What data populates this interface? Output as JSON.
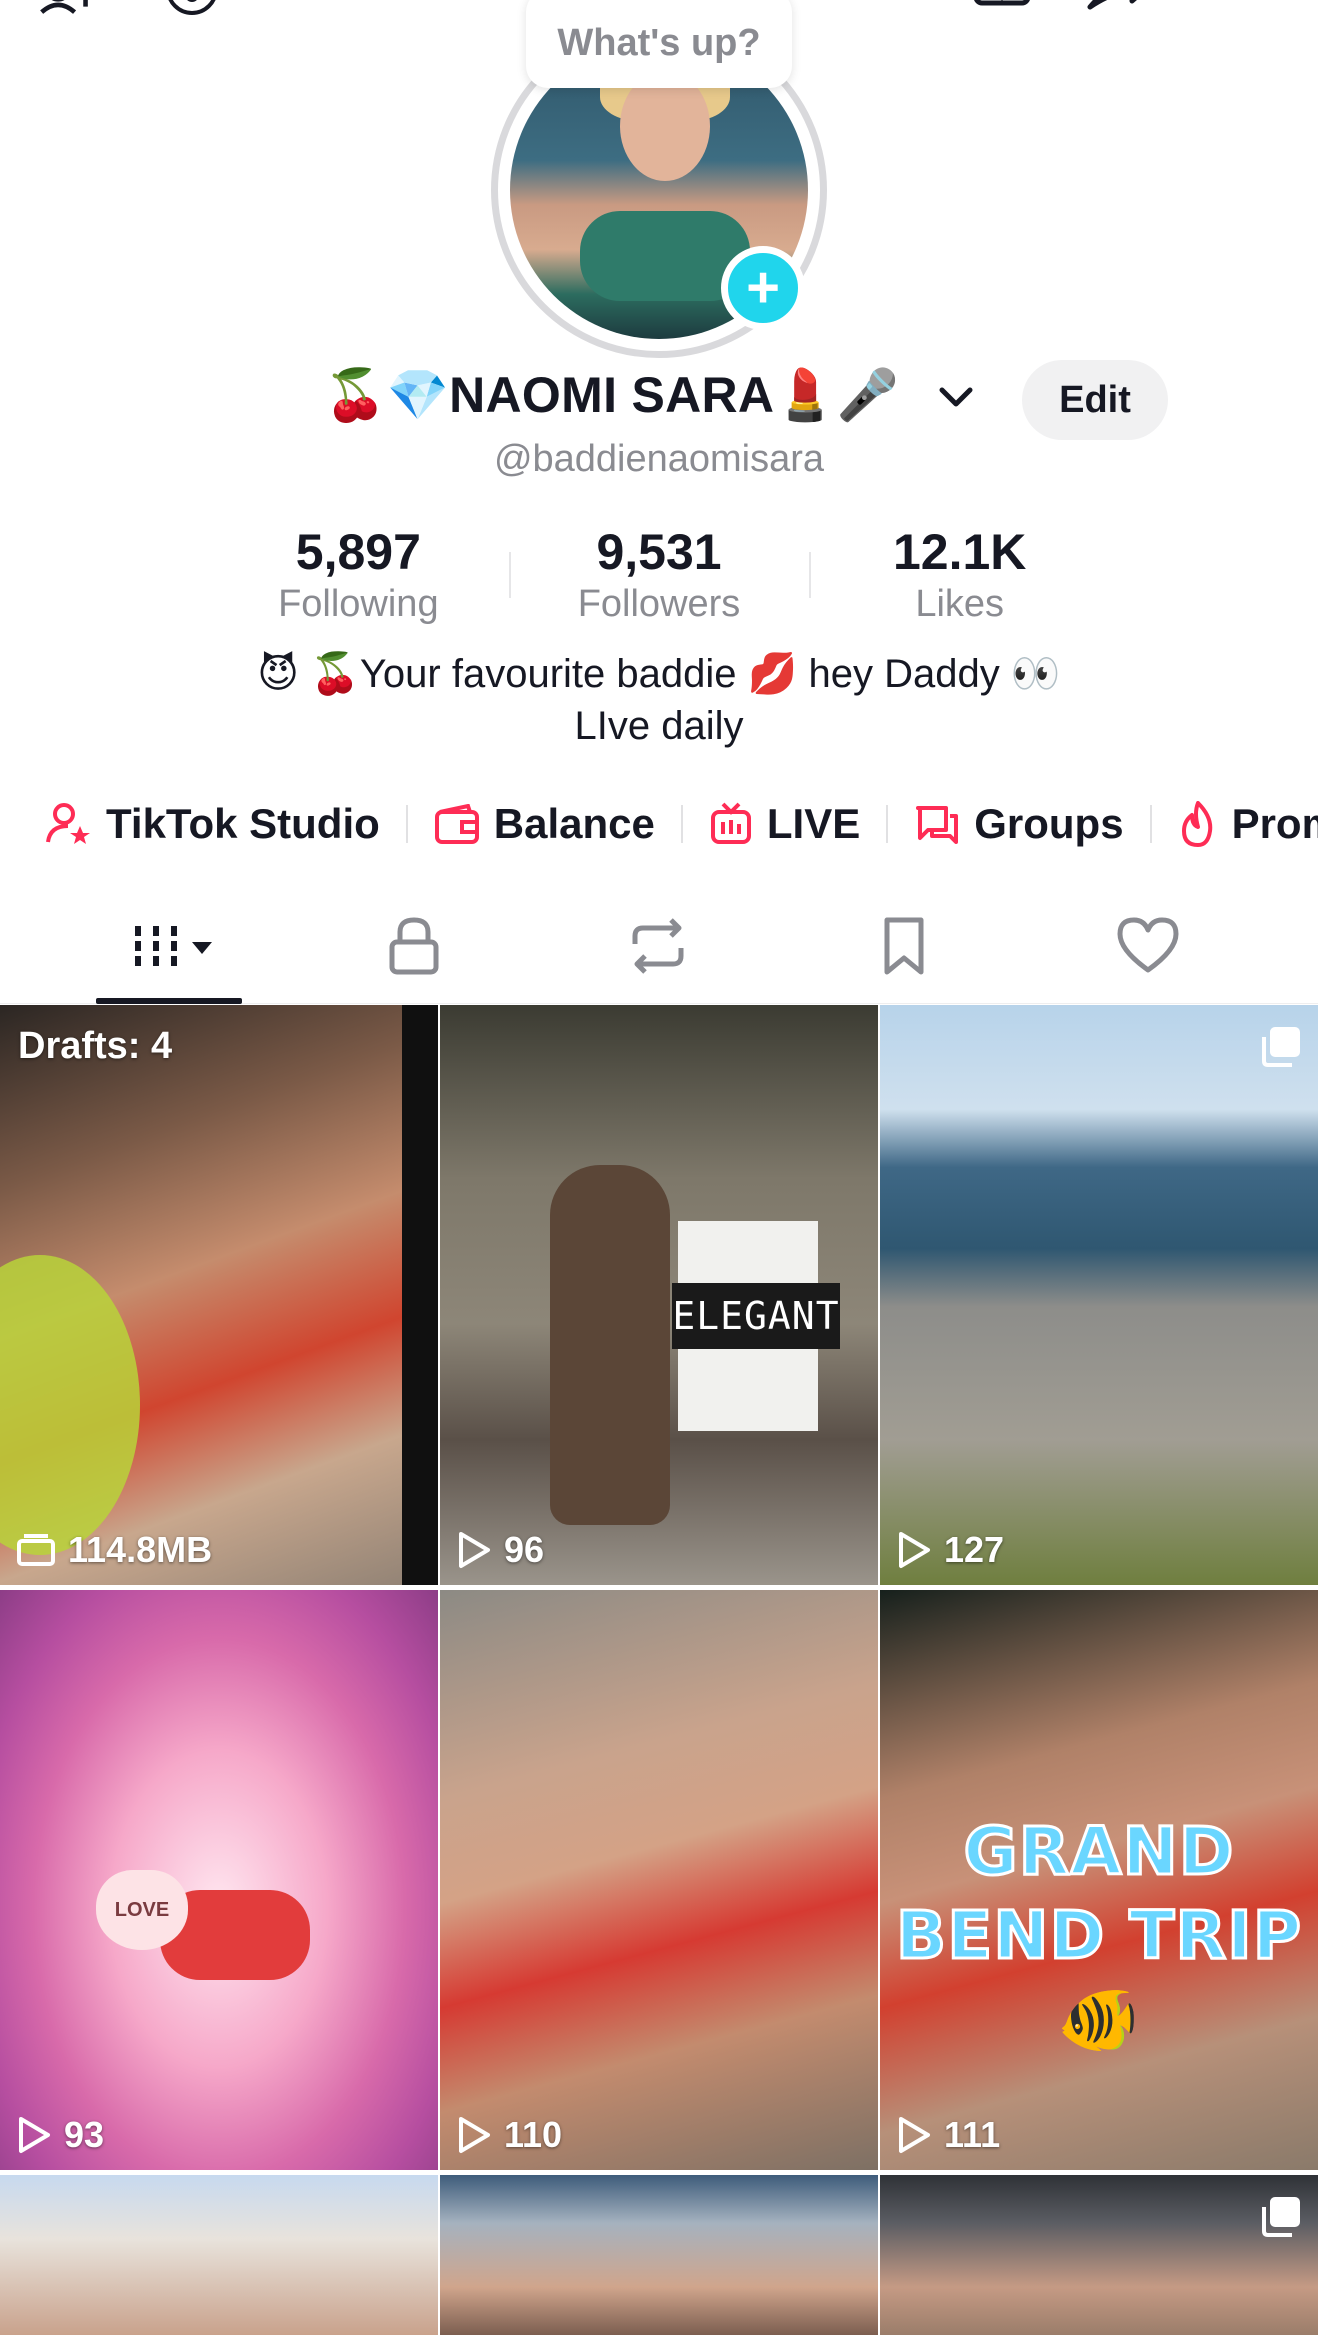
{
  "top": {
    "status_prompt": "What's up?"
  },
  "profile": {
    "name": "🍒💎NAOMI SARA💄🎤",
    "handle": "@baddienaomisara",
    "edit_label": "Edit"
  },
  "stats": [
    {
      "value": "5,897",
      "label": "Following"
    },
    {
      "value": "9,531",
      "label": "Followers"
    },
    {
      "value": "12.1K",
      "label": "Likes"
    }
  ],
  "bio": {
    "line1": "😈 🍒Your favourite baddie 💋 hey Daddy 👀",
    "line2": "LIve daily"
  },
  "shortcuts": [
    {
      "label": "TikTok Studio",
      "icon": "person-star-icon"
    },
    {
      "label": "Balance",
      "icon": "wallet-icon"
    },
    {
      "label": "LIVE",
      "icon": "tv-icon"
    },
    {
      "label": "Groups",
      "icon": "chat-bubbles-icon"
    },
    {
      "label": "Promo",
      "icon": "flame-icon"
    }
  ],
  "tabs": [
    {
      "name": "videos",
      "icon": "grid-icon",
      "selected": true
    },
    {
      "name": "private",
      "icon": "lock-icon"
    },
    {
      "name": "reposts",
      "icon": "repost-icon"
    },
    {
      "name": "favorites",
      "icon": "bookmark-icon"
    },
    {
      "name": "liked",
      "icon": "heart-icon"
    }
  ],
  "grid": {
    "drafts_label": "Drafts: 4",
    "items": [
      {
        "meta": "114.8MB",
        "meta_icon": "folder-icon"
      },
      {
        "meta": "96",
        "meta_icon": "play-icon",
        "overlay_text": "ELEGANT"
      },
      {
        "meta": "127",
        "meta_icon": "play-icon",
        "corner_icon": "carousel-icon"
      },
      {
        "meta": "93",
        "meta_icon": "play-icon",
        "overlay_text": "LOVE"
      },
      {
        "meta": "110",
        "meta_icon": "play-icon"
      },
      {
        "meta": "111",
        "meta_icon": "play-icon",
        "overlay_text": "GRAND BEND TRIP 🐠"
      },
      {
        "meta": "",
        "meta_icon": ""
      },
      {
        "meta": "",
        "meta_icon": ""
      },
      {
        "meta": "",
        "meta_icon": "",
        "corner_icon": "carousel-icon"
      }
    ]
  },
  "colors": {
    "accent_pink": "#fe2c55",
    "add_badge": "#20d5ec",
    "text_primary": "#161823",
    "text_secondary": "#8a8b91"
  }
}
